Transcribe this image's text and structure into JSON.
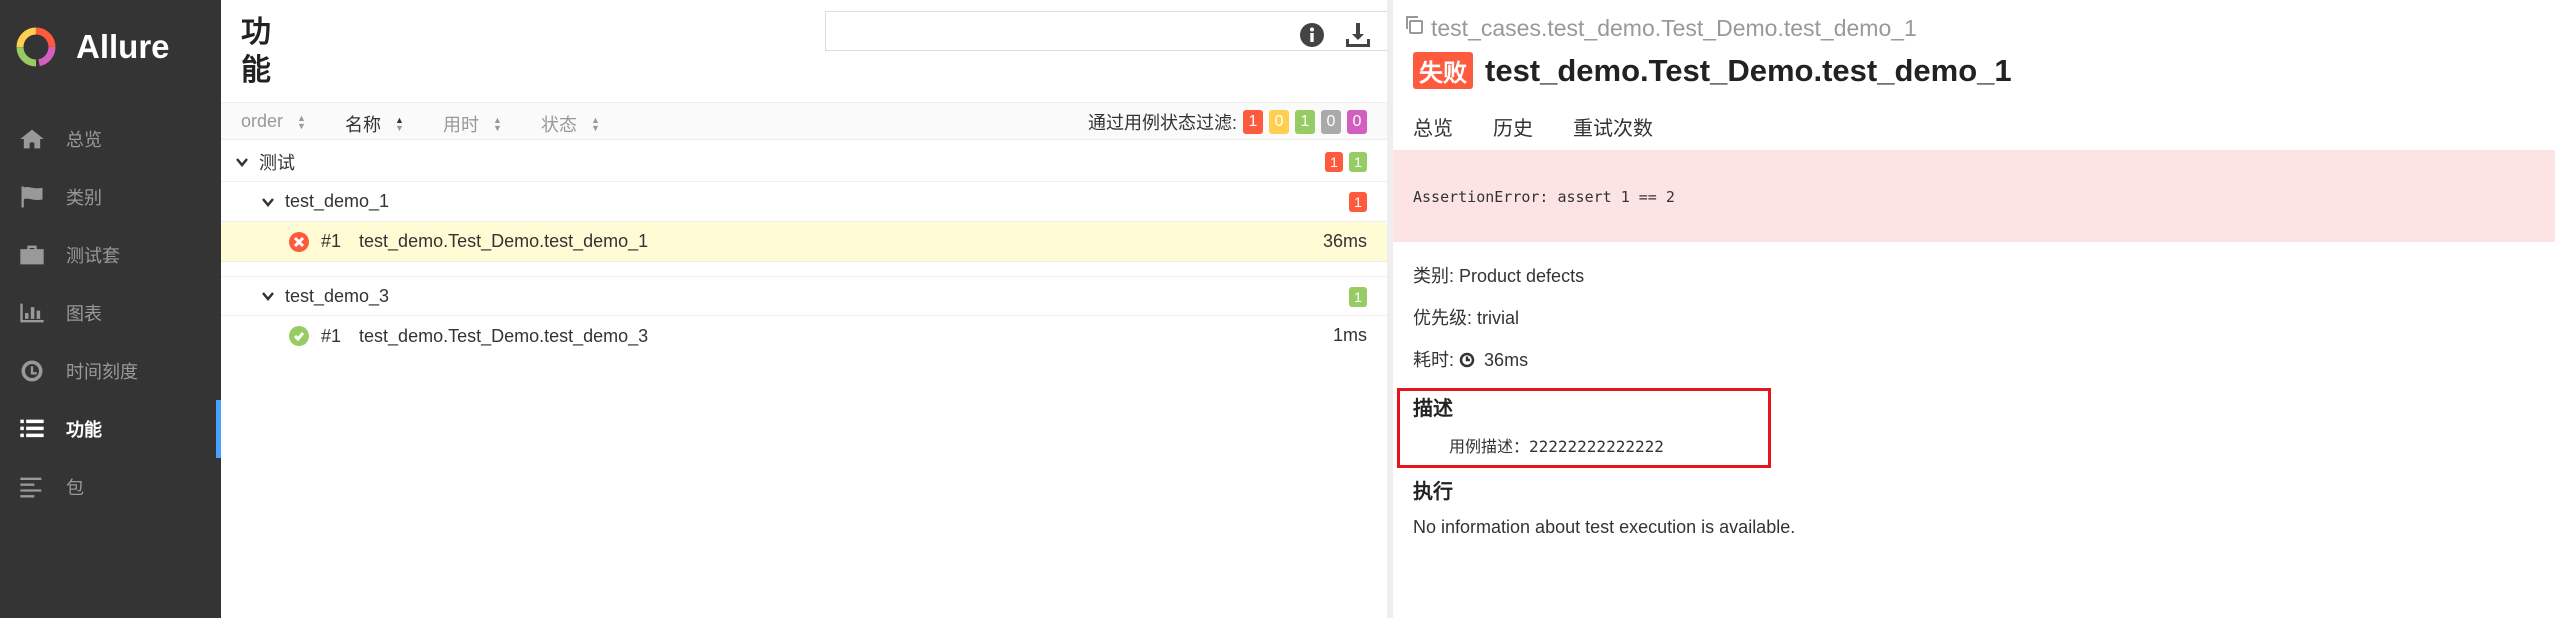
{
  "brand": {
    "name": "Allure"
  },
  "nav": [
    {
      "label": "总览",
      "icon": "home-icon"
    },
    {
      "label": "类别",
      "icon": "flag-icon"
    },
    {
      "label": "测试套",
      "icon": "briefcase-icon"
    },
    {
      "label": "图表",
      "icon": "bar-chart-icon"
    },
    {
      "label": "时间刻度",
      "icon": "clock-icon"
    },
    {
      "label": "功能",
      "icon": "list-icon"
    },
    {
      "label": "包",
      "icon": "align-left-icon"
    }
  ],
  "middle": {
    "title": "功能",
    "search_value": "",
    "sort": {
      "order": "order",
      "name": "名称",
      "duration": "用时",
      "status": "状态"
    },
    "filter_label": "通过用例状态过滤:",
    "filter_counts": {
      "failed": "1",
      "broken": "0",
      "passed": "1",
      "skipped": "0",
      "unknown": "0"
    },
    "tree": {
      "root": {
        "label": "测试",
        "failed": "1",
        "passed": "1"
      },
      "group1": {
        "label": "test_demo_1",
        "count": "1"
      },
      "leaf1": {
        "order": "#1",
        "name": "test_demo.Test_Demo.test_demo_1",
        "duration": "36ms"
      },
      "group2": {
        "label": "test_demo_3",
        "count": "1"
      },
      "leaf2": {
        "order": "#1",
        "name": "test_demo.Test_Demo.test_demo_3",
        "duration": "1ms"
      }
    }
  },
  "detail": {
    "breadcrumb": "test_cases.test_demo.Test_Demo.test_demo_1",
    "status_badge": "失败",
    "title": "test_demo.Test_Demo.test_demo_1",
    "tabs": [
      "总览",
      "历史",
      "重试次数"
    ],
    "assertion": "AssertionError: assert 1 == 2",
    "category": "类别: Product defects",
    "severity": "优先级: trivial",
    "duration_label": "耗时:",
    "duration_value": "36ms",
    "description_title": "描述",
    "description_text": "用例描述：22222222222222",
    "execution_title": "执行",
    "execution_text": "No information about test execution is available."
  },
  "colors": {
    "failed": "#fd5a3e",
    "broken": "#ffd050",
    "passed": "#97cc64",
    "skipped": "#aaaaaa",
    "unknown": "#d35ebe",
    "sidebar": "#343434",
    "accent": "#45a3ff"
  }
}
